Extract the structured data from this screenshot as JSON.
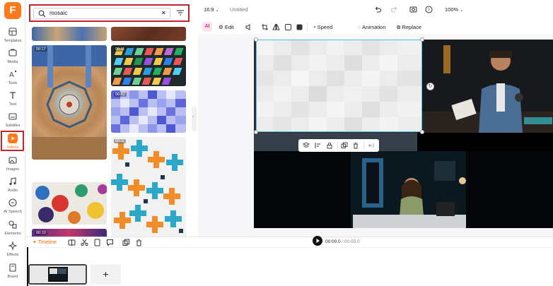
{
  "rail": {
    "logo": "F",
    "items": [
      {
        "label": "Templates",
        "icon": "templates-icon"
      },
      {
        "label": "Media",
        "icon": "media-icon"
      },
      {
        "label": "Tools",
        "icon": "tools-icon"
      },
      {
        "label": "Text",
        "icon": "text-icon"
      },
      {
        "label": "Subtitles",
        "icon": "subtitles-icon"
      },
      {
        "label": "Videos",
        "icon": "videos-icon"
      },
      {
        "label": "Images",
        "icon": "images-icon"
      },
      {
        "label": "Audio",
        "icon": "audio-icon"
      },
      {
        "label": "AI Speech",
        "icon": "ai-speech-icon"
      },
      {
        "label": "Elements",
        "icon": "elements-icon"
      },
      {
        "label": "Effects",
        "icon": "effects-icon"
      },
      {
        "label": "Brand",
        "icon": "brand-icon"
      }
    ],
    "active": "Videos"
  },
  "search": {
    "query": "mosaic",
    "clear_icon": "×"
  },
  "results": [
    {
      "duration": "",
      "kind": "arch-top"
    },
    {
      "duration": "",
      "kind": "brown-top"
    },
    {
      "duration": "00:17",
      "kind": "dome"
    },
    {
      "duration": "00:11",
      "kind": "glass"
    },
    {
      "duration": "00:42",
      "kind": "blue-pixel"
    },
    {
      "duration": "00:11",
      "kind": "cross"
    },
    {
      "duration": "",
      "kind": "gaudi"
    },
    {
      "duration": "00:10",
      "kind": "purple"
    }
  ],
  "topbar": {
    "ratio": "16:9",
    "title": "Untitled",
    "zoom": "100%"
  },
  "toolbar": {
    "ai": "AI",
    "edit": "Edit",
    "speed": "Speed",
    "animation": "Animation",
    "replace": "Replace"
  },
  "timeline": {
    "tab": "Timeline",
    "current": "00:00.0",
    "total": "/ 00:05.0",
    "add": "+"
  },
  "colors": {
    "accent": "#ff7a1a",
    "highlight": "#c0262d",
    "selection": "#4ec2e0"
  }
}
